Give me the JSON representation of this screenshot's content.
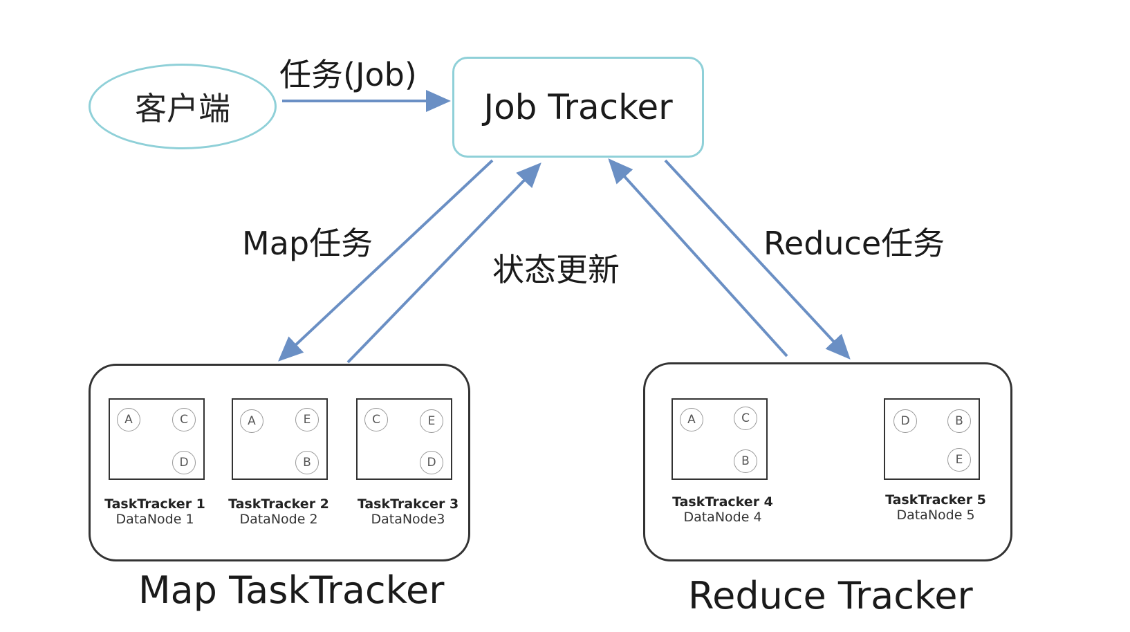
{
  "client_label": "客户端",
  "job_arrow_label": "任务(Job)",
  "job_tracker_label": "Job Tracker",
  "map_task_label": "Map任务",
  "status_update_label": "状态更新",
  "reduce_task_label": "Reduce任务",
  "map_group": {
    "title": "Map TaskTracker",
    "nodes": [
      {
        "name": "TaskTracker 1",
        "datanode": "DataNode 1",
        "blocks": [
          "A",
          "C",
          "D"
        ]
      },
      {
        "name": "TaskTracker 2",
        "datanode": "DataNode 2",
        "blocks": [
          "A",
          "E",
          "B"
        ]
      },
      {
        "name": "TaskTrakcer 3",
        "datanode": "DataNode3",
        "blocks": [
          "C",
          "E",
          "D"
        ]
      }
    ]
  },
  "reduce_group": {
    "title": "Reduce Tracker",
    "nodes": [
      {
        "name": "TaskTracker 4",
        "datanode": "DataNode 4",
        "blocks": [
          "A",
          "C",
          "B"
        ]
      },
      {
        "name": "TaskTracker 5",
        "datanode": "DataNode 5",
        "blocks": [
          "D",
          "B",
          "E"
        ]
      }
    ]
  },
  "colors": {
    "arrow": "#6a8fc4",
    "box_border": "#8fd0d8",
    "group_border": "#333333"
  }
}
